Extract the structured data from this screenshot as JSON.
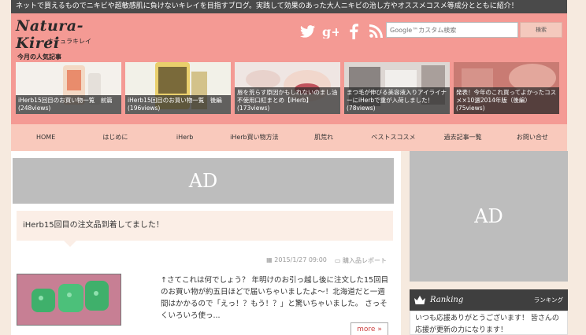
{
  "topbar": {
    "text": "ネットで買えるものでニキビや超敏感肌に負けないキレイを目指すブログ。実践して効果のあった大人ニキビの治し方やオススメコスメ等成分とともに紹介！"
  },
  "header": {
    "logo_main": "Natura-Kirei",
    "logo_sub": "ナチュラキレイ",
    "social_icons": [
      "twitter-icon",
      "google-plus-icon",
      "facebook-icon",
      "rss-icon"
    ],
    "search_placeholder": "Google™カスタム検索",
    "search_button": "検索"
  },
  "popular": {
    "title": "今月の人気記事",
    "items": [
      {
        "label": "iHerb15回目のお買い物一覧　前篇 (248views)"
      },
      {
        "label": "iHerb15回目のお買い物一覧　後編 (196views)"
      },
      {
        "label": "唇を荒らす原因かもしれないのまし油不使用口紅まとめ【iHerb】(173views)"
      },
      {
        "label": "まつ毛が伸びる美容液入りアイライナーにiHerbで重が入荷しました！(78views)"
      },
      {
        "label": "発表！今年のこれ買ってよかったコスメ×10選2014年版（後編）(75views)"
      }
    ]
  },
  "nav": {
    "items": [
      "HOME",
      "はじめに",
      "iHerb",
      "iHerb買い物方法",
      "肌荒れ",
      "ベストスコスメ",
      "過去記事一覧",
      "お問い合せ"
    ]
  },
  "main": {
    "ad_label": "AD",
    "post_title": "iHerb15回目の注文品到着してました！",
    "date": "2015/1/27 09:00",
    "category": "購入品レポート",
    "excerpt": "↑さてこれは何でしょう？ 年明けのお引っ越し後に注文した15回目のお買い物が約五日ほどで届いちゃいましたよ～！北海道だと一週間はかかるので「えっ！？もう！？」と驚いちゃいました。 さっそくいろいろ使っ...",
    "more_label": "more »"
  },
  "sidebar": {
    "ad_label": "AD",
    "ranking_title": "Ranking",
    "ranking_sub": "ランキング",
    "ranking_text": "いつも応援ありがとうございます！ 皆さんの応援が更新の力になります！"
  },
  "colors": {
    "header": "#f49a94",
    "nav": "#f9c9bc",
    "topbar": "#4a4a4a",
    "ad": "#bdbdbd"
  }
}
